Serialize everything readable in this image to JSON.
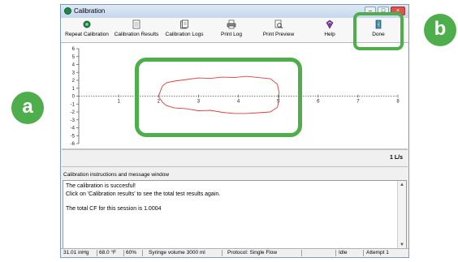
{
  "window": {
    "title": "Calibration",
    "min_glyph": "–",
    "max_glyph": "□",
    "close_glyph": "×"
  },
  "toolbar": {
    "items": [
      {
        "label": "Repeat Calibration",
        "icon": "record-icon"
      },
      {
        "label": "Calibration Results",
        "icon": "document-icon"
      },
      {
        "label": "Calibration Logs",
        "icon": "logs-icon"
      },
      {
        "label": "Print Log",
        "icon": "printer-icon"
      },
      {
        "label": "Print Preview",
        "icon": "print-preview-icon"
      },
      {
        "label": "Help",
        "icon": "help-book-icon"
      },
      {
        "label": "Done",
        "icon": "exit-door-icon"
      }
    ]
  },
  "chart_data": {
    "type": "line",
    "xlim": [
      0,
      8
    ],
    "ylim": [
      -6,
      6
    ],
    "x_ticks": [
      "1",
      "2",
      "3",
      "4",
      "5",
      "6",
      "7",
      "8"
    ],
    "y_ticks": [
      "6",
      "5",
      "4",
      "3",
      "2",
      "1",
      "0",
      "-1",
      "-2",
      "-3",
      "-4",
      "-5",
      "-6"
    ],
    "series": [
      {
        "color": "#e53b3b",
        "x": [
          2.0,
          2.05,
          2.1,
          2.2,
          2.4,
          2.7,
          3.0,
          3.3,
          3.6,
          3.9,
          4.2,
          4.5,
          4.8,
          4.98,
          5.02,
          5.02,
          4.98,
          4.8,
          4.5,
          4.2,
          3.9,
          3.6,
          3.3,
          3.0,
          2.7,
          2.4,
          2.2,
          2.1,
          2.05,
          2.0,
          2.0
        ],
        "y": [
          0,
          0.7,
          1.3,
          1.7,
          1.9,
          2.1,
          2.3,
          2.25,
          2.4,
          2.35,
          2.5,
          2.35,
          2.2,
          1.5,
          0.5,
          -0.5,
          -1.4,
          -2.0,
          -2.1,
          -2.2,
          -2.2,
          -2.05,
          -1.8,
          -1.85,
          -1.6,
          -1.5,
          -1.2,
          -0.8,
          -0.4,
          -0.1,
          0
        ]
      }
    ]
  },
  "flow_scale": "1 L/s",
  "messages": {
    "header": "Calibration instructions and message window",
    "lines": [
      "The calibration is succesful!",
      "Click on 'Calibration results' to see the total test results again.",
      "The total CF for this session is 1.0004"
    ],
    "scroll_up_glyph": "▲",
    "scroll_down_glyph": "▼"
  },
  "status": {
    "pressure": "31.01 inHg",
    "temperature": "68.0 °F",
    "humidity": "60%",
    "syringe": "Syringe volume 3000 ml",
    "protocol": "Protocol: Single Flow",
    "state": "Idle",
    "attempt": "Attempt 1"
  },
  "callouts": {
    "a": "a",
    "b": "b"
  },
  "colors": {
    "accent_green": "#4fae4c",
    "trace_red": "#e53b3b"
  }
}
